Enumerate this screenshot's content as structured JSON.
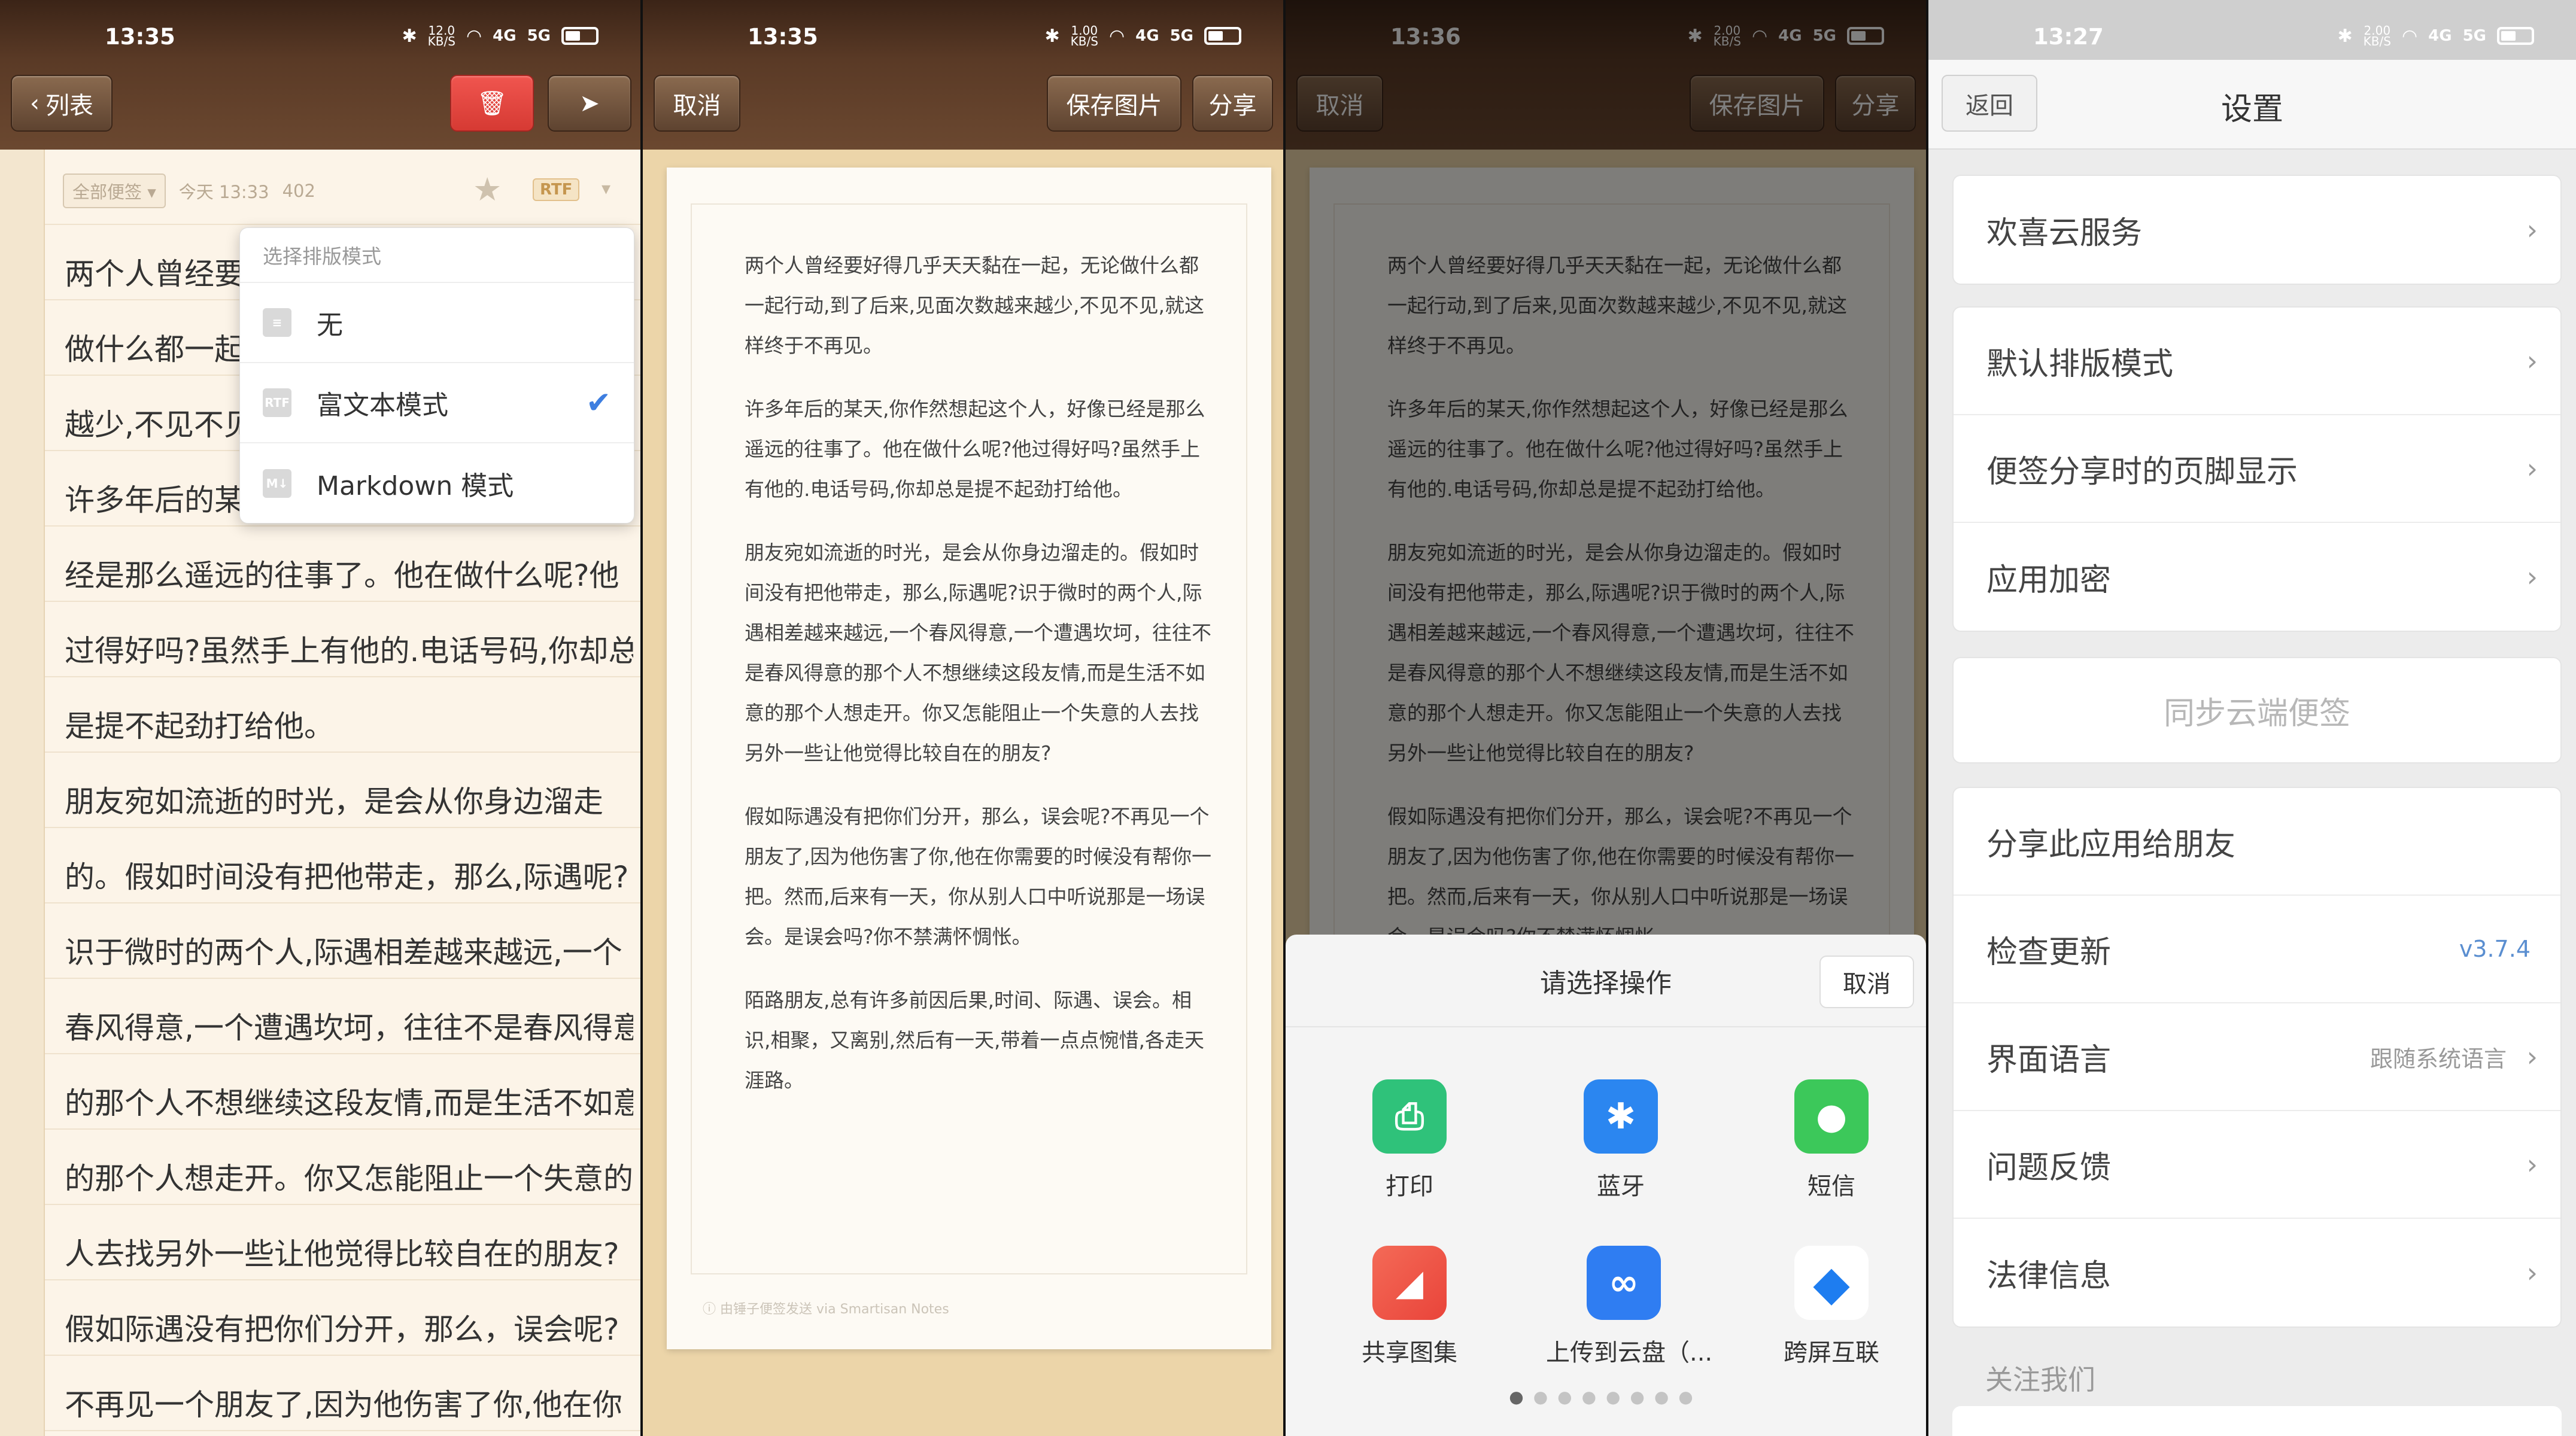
{
  "status": {
    "p1_time": "13:35",
    "p1_speed": "12.0",
    "p2_time": "13:35",
    "p2_speed": "1.00",
    "p3_time": "13:36",
    "p3_speed": "2.00",
    "p4_time": "13:27",
    "p4_speed": "2.00",
    "unit": "KB/S",
    "net": "4G",
    "net2": "5G"
  },
  "p1": {
    "back": "列表",
    "folder": "全部便签",
    "date": "今天 13:33",
    "count": "402",
    "rtf": "RTF",
    "lines": [
      "两个人曾经要",
      "做什么都一起",
      "越少,不见不见",
      "许多年后的某",
      "经是那么遥远的往事了。他在做什么呢?他",
      "过得好吗?虽然手上有他的.电话号码,你却总",
      "是提不起劲打给他。",
      "朋友宛如流逝的时光，是会从你身边溜走",
      "的。假如时间没有把他带走，那么,际遇呢?",
      "识于微时的两个人,际遇相差越来越远,一个",
      "春风得意,一个遭遇坎坷，往往不是春风得意",
      "的那个人不想继续这段友情,而是生活不如意",
      "的那个人想走开。你又怎能阻止一个失意的",
      "人去找另外一些让他觉得比较自在的朋友?",
      "假如际遇没有把你们分开，那么，误会呢?",
      "不再见一个朋友了,因为他伤害了你,他在你"
    ],
    "popup": {
      "title": "选择排版模式",
      "opt1": "无",
      "opt2": "富文本模式",
      "opt3": "Markdown 模式",
      "icon1": "≡",
      "icon2": "RTF",
      "icon3": "M↓"
    }
  },
  "p2": {
    "cancel": "取消",
    "save": "保存图片",
    "share": "分享",
    "paras": [
      "两个人曾经要好得几乎天天黏在一起，无论做什么都一起行动,到了后来,见面次数越来越少,不见不见,就这样终于不再见。",
      "许多年后的某天,你作然想起这个人，好像已经是那么遥远的往事了。他在做什么呢?他过得好吗?虽然手上有他的.电话号码,你却总是提不起劲打给他。",
      "朋友宛如流逝的时光，是会从你身边溜走的。假如时间没有把他带走，那么,际遇呢?识于微时的两个人,际遇相差越来越远,一个春风得意,一个遭遇坎坷，往往不是春风得意的那个人不想继续这段友情,而是生活不如意的那个人想走开。你又怎能阻止一个失意的人去找另外一些让他觉得比较自在的朋友?",
      "假如际遇没有把你们分开，那么，误会呢?不再见一个朋友了,因为他伤害了你,他在你需要的时候没有帮你一把。然而,后来有一天，你从别人口中听说那是一场误会。是误会吗?你不禁满怀惆怅。",
      "陌路朋友,总有许多前因后果,时间、际遇、误会。相识,相聚，又离别,然后有一天,带着一点点惋惜,各走天涯路。"
    ],
    "footnote": "由锤子便签发送 via Smartisan Notes"
  },
  "p3": {
    "sheet_title": "请选择操作",
    "sheet_cancel": "取消",
    "apps": [
      {
        "label": "打印",
        "color": "#2fc27a"
      },
      {
        "label": "蓝牙",
        "color": "#2b86f0"
      },
      {
        "label": "短信",
        "color": "#3cc85a"
      },
      {
        "label": "共享图集",
        "color": "#ef5a48"
      },
      {
        "label": "上传到云盘（...",
        "color": "#2f7df2"
      },
      {
        "label": "跨屏互联",
        "color": "#1e7df0"
      }
    ]
  },
  "p4": {
    "back": "返回",
    "title": "设置",
    "cloud": "欢喜云服务",
    "layout": "默认排版模式",
    "footer": "便签分享时的页脚显示",
    "lock": "应用加密",
    "sync": "同步云端便签",
    "shareapp": "分享此应用给朋友",
    "update": "检查更新",
    "version": "v3.7.4",
    "lang": "界面语言",
    "lang_val": "跟随系统语言",
    "feedback": "问题反馈",
    "legal": "法律信息",
    "follow": "关注我们"
  }
}
